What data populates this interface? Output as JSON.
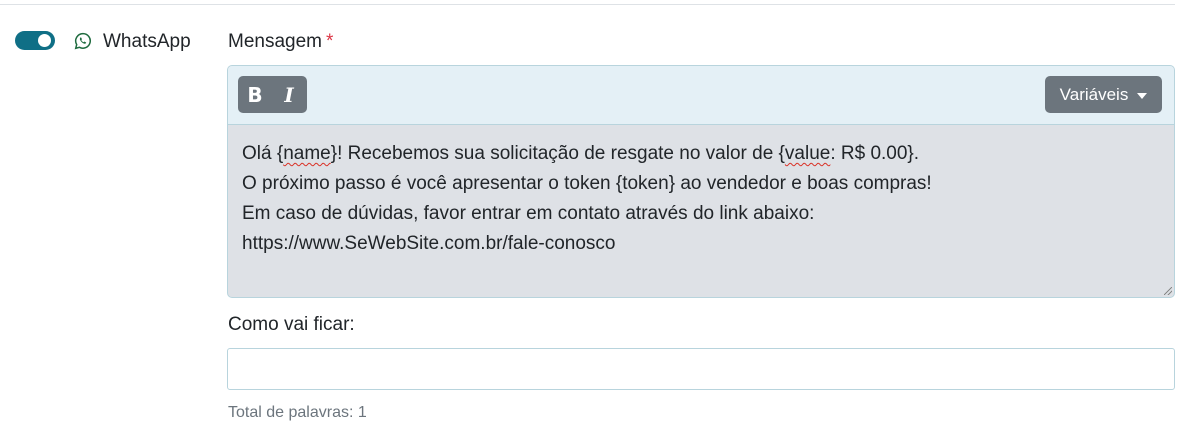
{
  "channel": {
    "enabled": true,
    "label": "WhatsApp",
    "icon": "whatsapp-icon"
  },
  "message_field": {
    "label": "Mensagem",
    "required_marker": "*",
    "toolbar": {
      "bold_label": "B",
      "italic_label": "I",
      "variables_label": "Variáveis"
    },
    "lines": [
      {
        "parts": [
          {
            "text": "Olá {",
            "squiggle": false
          },
          {
            "text": "name",
            "squiggle": true
          },
          {
            "text": "}! Recebemos sua solicitação de resgate no valor de {",
            "squiggle": false
          },
          {
            "text": "value",
            "squiggle": true
          },
          {
            "text": ": R$ 0.00}.",
            "squiggle": false
          }
        ]
      },
      {
        "parts": [
          {
            "text": "O próximo passo é você apresentar o token {token} ao vendedor e boas compras!",
            "squiggle": false
          }
        ]
      },
      {
        "parts": [
          {
            "text": "Em caso de dúvidas, favor entrar em contato através do link abaixo:",
            "squiggle": false
          }
        ]
      },
      {
        "parts": [
          {
            "text": "https://www.SeWebSite.com.br/fale-conosco",
            "squiggle": false
          }
        ]
      }
    ]
  },
  "preview": {
    "label": "Como vai ficar:",
    "value": ""
  },
  "word_count_text": "Total de palavras: 1",
  "colors": {
    "toggle_on": "#0f6f86",
    "required": "#dc3545",
    "button_gray": "#6c757d"
  }
}
